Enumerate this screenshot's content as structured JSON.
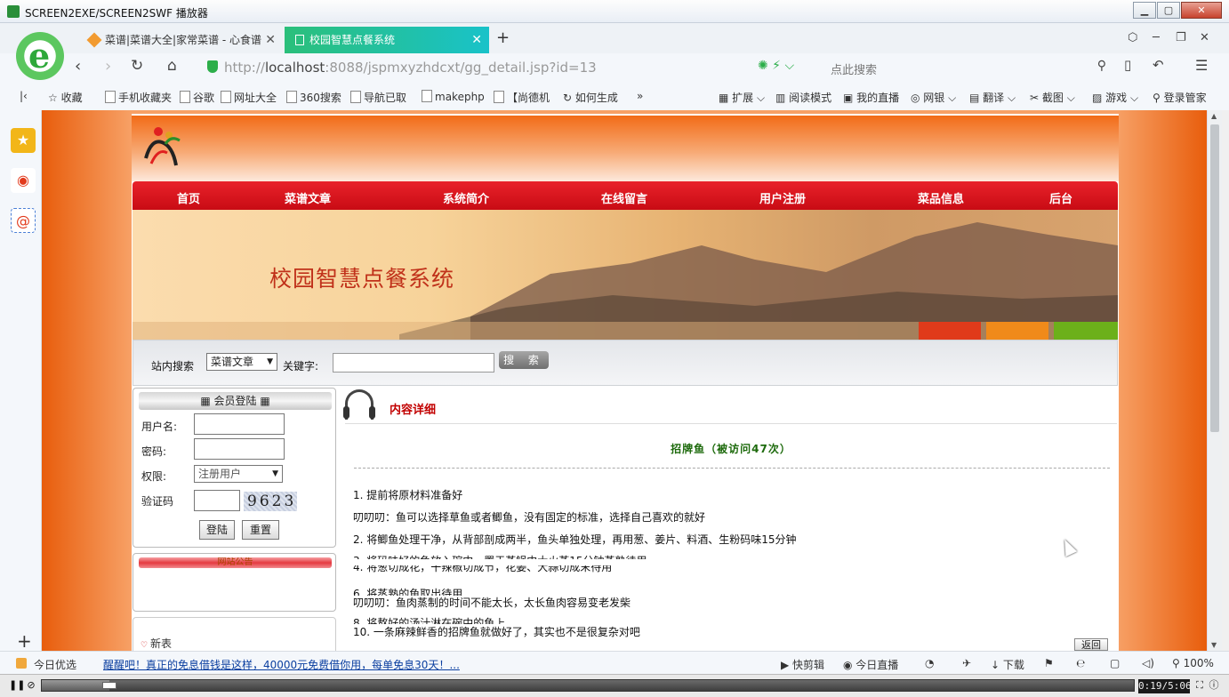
{
  "window": {
    "title": "SCREEN2EXE/SCREEN2SWF 播放器",
    "min_label": "▁",
    "max_label": "▢",
    "close_label": "✕"
  },
  "browser": {
    "logo_letter": "e",
    "tabs": [
      {
        "label": "菜谱|菜谱大全|家常菜谱 - 心食谱",
        "active": false
      },
      {
        "label": "校园智慧点餐系统",
        "active": true
      }
    ],
    "tab_close": "✕",
    "new_tab": "+",
    "url_prefix": "http://",
    "url_host": "localhost",
    "url_rest": ":8088/jspmxyzhdcxt/gg_detail.jsp?id=13",
    "search_placeholder": "点此搜索",
    "bookmarks": [
      "收藏",
      "手机收藏夹",
      "谷歌",
      "网址大全",
      "360搜索",
      "导航已取",
      "makephp",
      "【尚德机",
      "如何生成"
    ],
    "bookmarks_more": "»",
    "right_tools": [
      "扩展",
      "阅读模式",
      "我的直播",
      "网银",
      "翻译",
      "截图",
      "游戏",
      "登录管家"
    ]
  },
  "site": {
    "nav": [
      "首页",
      "菜谱文章",
      "系统简介",
      "在线留言",
      "用户注册",
      "菜品信息",
      "后台"
    ],
    "banner_title": "校园智慧点餐系统",
    "search": {
      "label": "站内搜索",
      "category": "菜谱文章",
      "keyword_label": "关键字:",
      "button": "搜 索"
    },
    "login": {
      "title": "会员登陆",
      "username_label": "用户名:",
      "password_label": "密码:",
      "role_label": "权限:",
      "role_value": "注册用户",
      "captcha_label": "验证码",
      "captcha_text": "9623",
      "login_button": "登陆",
      "reset_button": "重置"
    },
    "box2_title": "网站公告",
    "box3_item": "新表",
    "detail": {
      "section_title": "内容详细",
      "title": "招牌鱼（被访问47次）",
      "paragraphs": [
        "1. 提前将原材料准备好",
        "叨叨叨：鱼可以选择草鱼或者鲫鱼，没有固定的标准，选择自己喜欢的就好",
        "2. 将鲫鱼处理干净，从背部剖成两半，鱼头单独处理，再用葱、姜片、料酒、生粉码味15分钟",
        "3. 将码味好的鱼放入碗中，置于蒸锅中大火蒸15分钟蒸熟待用",
        "4. 将葱切成花，干辣椒切成节，花姜、大蒜切成末待用",
        "6. 将蒸熟的鱼取出待用",
        "叨叨叨：鱼肉蒸制的时间不能太长，太长鱼肉容易变老发柴",
        "8. 将熬好的汤汁淋在碗中的鱼上",
        "10. 一条麻辣鲜香的招牌鱼就做好了，其实也不是很复杂对吧"
      ],
      "back_button": "返回"
    }
  },
  "statusbar": {
    "left": "今日优选",
    "news": "醒醒吧！真正的免息借钱是这样，40000元免费借你用，每单免息30天！...",
    "items": [
      "快剪辑",
      "今日直播",
      "下载"
    ],
    "zoom": "100%"
  },
  "player": {
    "time": "0:19/5:06",
    "progress": 0.062
  }
}
